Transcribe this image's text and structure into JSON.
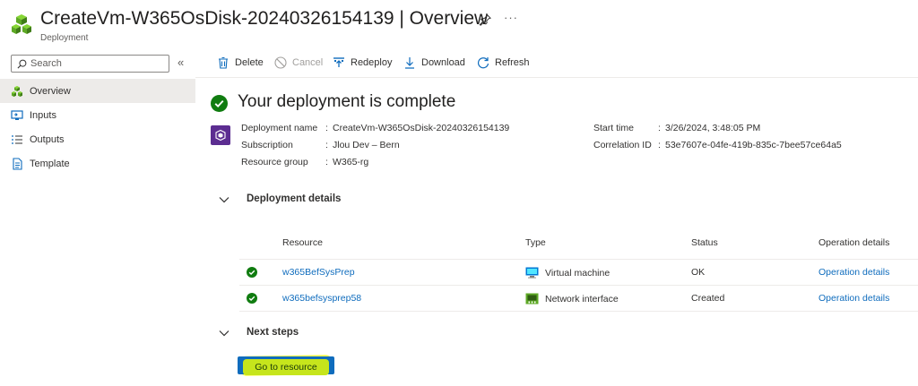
{
  "header": {
    "title": "CreateVm-W365OsDisk-20240326154139 | Overview",
    "subtitle": "Deployment",
    "more": "···"
  },
  "sidebar": {
    "search_placeholder": "Search",
    "collapse": "«",
    "items": [
      {
        "label": "Overview",
        "icon": "deployment-icon",
        "active": true
      },
      {
        "label": "Inputs",
        "icon": "inputs-icon"
      },
      {
        "label": "Outputs",
        "icon": "outputs-icon"
      },
      {
        "label": "Template",
        "icon": "template-icon"
      }
    ]
  },
  "toolbar": {
    "delete": "Delete",
    "cancel": "Cancel",
    "redeploy": "Redeploy",
    "download": "Download",
    "refresh": "Refresh"
  },
  "status": {
    "title": "Your deployment is complete"
  },
  "essentials": {
    "deployment_name_label": "Deployment name",
    "deployment_name": "CreateVm-W365OsDisk-20240326154139",
    "subscription_label": "Subscription",
    "subscription": "Jlou Dev – Bern",
    "resource_group_label": "Resource group",
    "resource_group": "W365-rg",
    "start_time_label": "Start time",
    "start_time": "3/26/2024, 3:48:05 PM",
    "correlation_label": "Correlation ID",
    "correlation": "53e7607e-04fe-419b-835c-7bee57ce64a5",
    "separator": ":"
  },
  "details": {
    "title": "Deployment details",
    "columns": [
      "Resource",
      "Type",
      "Status",
      "Operation details"
    ],
    "rows": [
      {
        "resource": "w365BefSysPrep",
        "type": "Virtual machine",
        "type_icon": "virtual-machine-icon",
        "status": "OK",
        "op": "Operation details"
      },
      {
        "resource": "w365befsysprep58",
        "type": "Network interface",
        "type_icon": "network-interface-icon",
        "status": "Created",
        "op": "Operation details"
      }
    ]
  },
  "next_steps": {
    "title": "Next steps",
    "button": "Go to resource"
  },
  "colors": {
    "link": "#0f6cbd",
    "success": "#107c10",
    "primary": "#0f6cbd",
    "highlight": "#ffff3b"
  }
}
